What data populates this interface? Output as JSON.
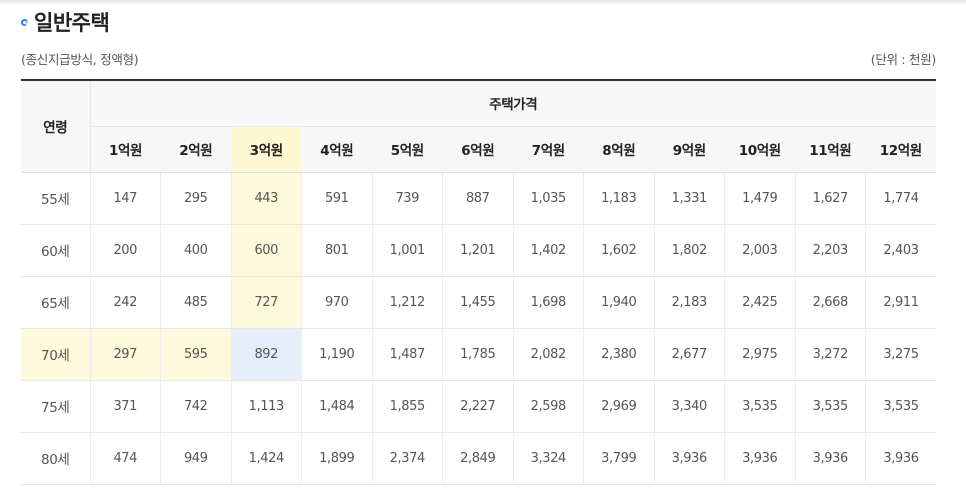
{
  "section": {
    "title": "일반주택",
    "note_left": "(종신지급방식, 정액형)",
    "note_right": "(단위 : 천원)"
  },
  "table": {
    "age_header": "연령",
    "group_header": "주택가격",
    "columns": [
      "1억원",
      "2억원",
      "3억원",
      "4억원",
      "5억원",
      "6억원",
      "7억원",
      "8억원",
      "9억원",
      "10억원",
      "11억원",
      "12억원"
    ],
    "highlight_column_index": 2,
    "highlight_row_index": 3,
    "highlight_color": "#fdf9dc",
    "intersection_color": "#e6eefa",
    "rows": [
      {
        "age": "55세",
        "values": [
          "147",
          "295",
          "443",
          "591",
          "739",
          "887",
          "1,035",
          "1,183",
          "1,331",
          "1,479",
          "1,627",
          "1,774"
        ]
      },
      {
        "age": "60세",
        "values": [
          "200",
          "400",
          "600",
          "801",
          "1,001",
          "1,201",
          "1,402",
          "1,602",
          "1,802",
          "2,003",
          "2,203",
          "2,403"
        ]
      },
      {
        "age": "65세",
        "values": [
          "242",
          "485",
          "727",
          "970",
          "1,212",
          "1,455",
          "1,698",
          "1,940",
          "2,183",
          "2,425",
          "2,668",
          "2,911"
        ]
      },
      {
        "age": "70세",
        "values": [
          "297",
          "595",
          "892",
          "1,190",
          "1,487",
          "1,785",
          "2,082",
          "2,380",
          "2,677",
          "2,975",
          "3,272",
          "3,275"
        ]
      },
      {
        "age": "75세",
        "values": [
          "371",
          "742",
          "1,113",
          "1,484",
          "1,855",
          "2,227",
          "2,598",
          "2,969",
          "3,340",
          "3,535",
          "3,535",
          "3,535"
        ]
      },
      {
        "age": "80세",
        "values": [
          "474",
          "949",
          "1,424",
          "1,899",
          "2,374",
          "2,849",
          "3,324",
          "3,799",
          "3,936",
          "3,936",
          "3,936",
          "3,936"
        ]
      }
    ]
  }
}
